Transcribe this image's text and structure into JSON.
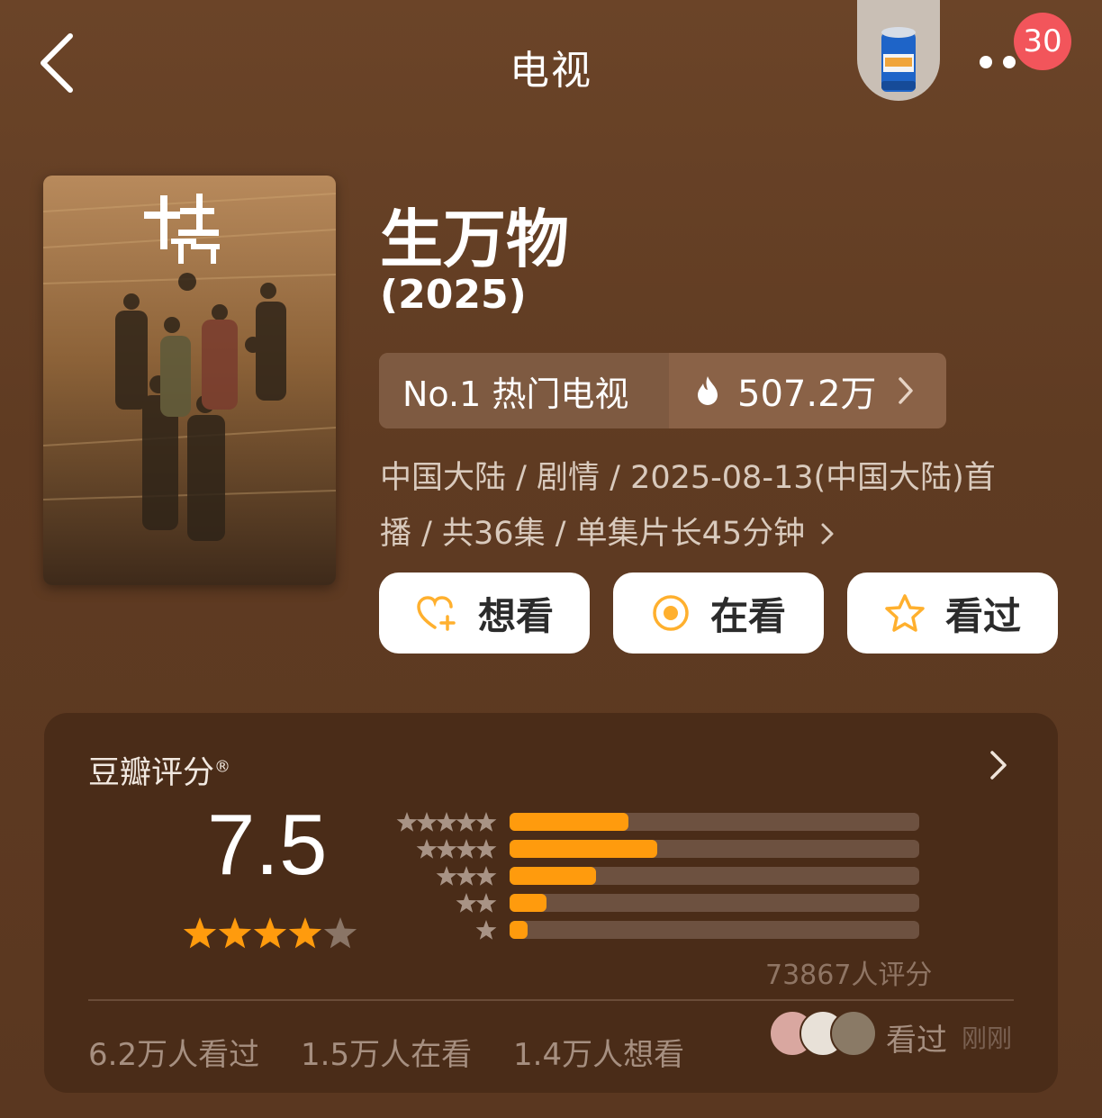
{
  "header": {
    "title": "电视",
    "badge_count": "30"
  },
  "movie": {
    "title": "生万物",
    "year": "(2025)",
    "rank_label": "No.1 热门电视",
    "heat_value": "507.2万",
    "meta_line1": "中国大陆 / 剧情 / 2025-08-13(中国大陆)首",
    "meta_line2": "播 / 共36集 / 单集片长45分钟"
  },
  "actions": {
    "want": "想看",
    "watching": "在看",
    "watched": "看过"
  },
  "rating": {
    "label": "豆瓣评分",
    "mark": "®",
    "score": "7.5",
    "stars": 4,
    "distribution": [
      {
        "stars": 5,
        "fraction": 0.29
      },
      {
        "stars": 4,
        "fraction": 0.36
      },
      {
        "stars": 3,
        "fraction": 0.21
      },
      {
        "stars": 2,
        "fraction": 0.09
      },
      {
        "stars": 1,
        "fraction": 0.045
      }
    ],
    "votes": "73867人评分"
  },
  "stats": {
    "watched": "6.2万人看过",
    "watching": "1.5万人在看",
    "want": "1.4万人想看",
    "recent_action": "看过",
    "recent_time": "刚刚"
  },
  "colors": {
    "accent": "#ff9b0d",
    "badge": "#f2555b",
    "background": "#5f3b22"
  }
}
